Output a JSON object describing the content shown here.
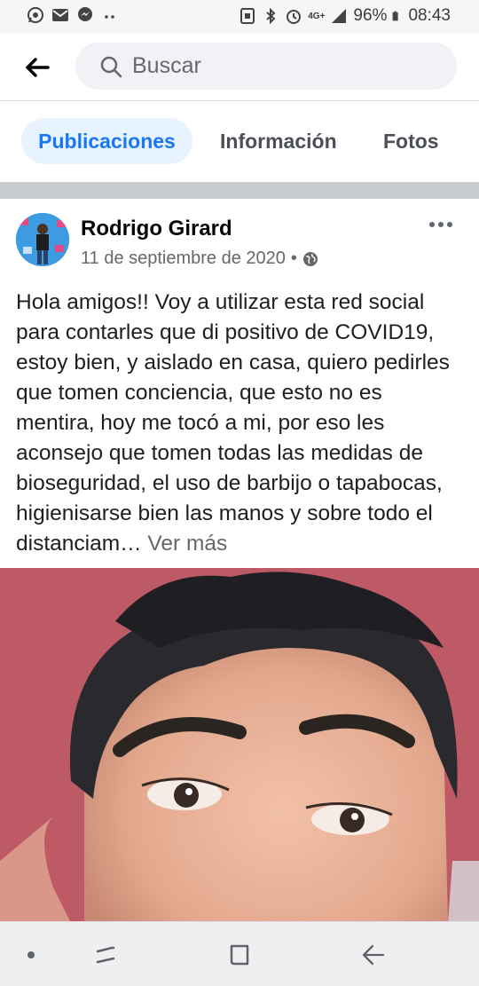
{
  "status_bar": {
    "left_icons": [
      "whatsapp-icon",
      "mail-icon",
      "messenger-icon",
      "more-dots-icon"
    ],
    "network": "4G+",
    "battery": "96%",
    "time": "08:43"
  },
  "search": {
    "placeholder": "Buscar"
  },
  "tabs": [
    {
      "label": "Publicaciones",
      "active": true
    },
    {
      "label": "Información",
      "active": false
    },
    {
      "label": "Fotos",
      "active": false
    }
  ],
  "post": {
    "author": "Rodrigo Girard",
    "date": "11 de septiembre de 2020",
    "separator": "•",
    "privacy_icon": "globe-icon",
    "text": "Hola amigos!! Voy a utilizar esta red social para contarles que di positivo de COVID19, estoy bien, y aislado en casa, quiero pedirles que tomen conciencia, que esto no es mentira, hoy me tocó a mi, por eso les aconsejo que tomen todas las medidas de bioseguridad, el uso de barbijo o tapabocas, higienisarse bien las manos y sobre todo el distanciam…",
    "see_more": "Ver más"
  },
  "colors": {
    "accent": "#1877f2",
    "tab_active_bg": "#e7f3ff",
    "separator": "#c9ccd1"
  }
}
